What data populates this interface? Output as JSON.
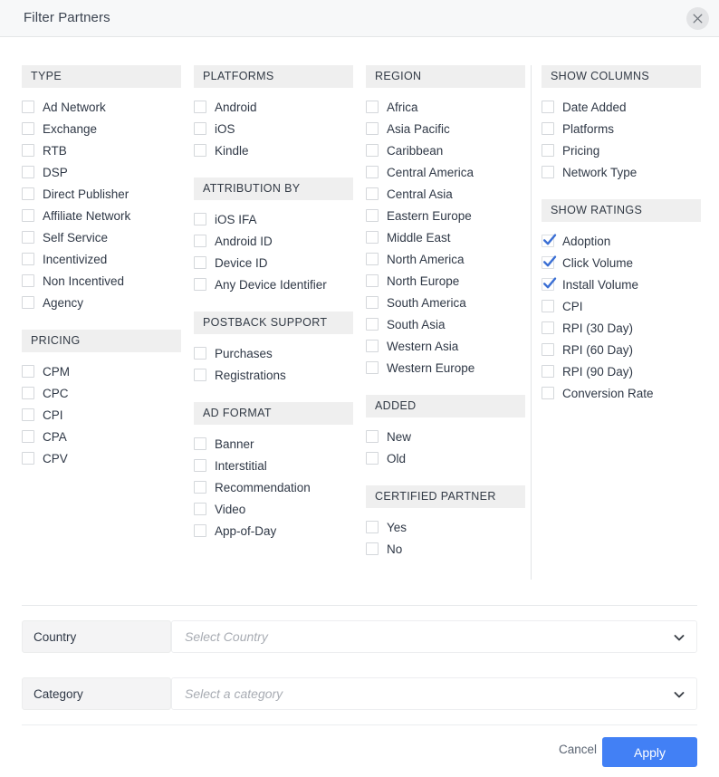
{
  "dialog": {
    "title": "Filter Partners",
    "close_icon": "close-icon"
  },
  "colors": {
    "accent": "#4280f5",
    "check": "#3b6fd4",
    "group_header_bg": "#efefef",
    "header_bg": "#f7f8f9"
  },
  "columns": [
    {
      "groups": [
        {
          "title": "TYPE",
          "options": [
            {
              "label": "Ad Network",
              "checked": false
            },
            {
              "label": "Exchange",
              "checked": false
            },
            {
              "label": "RTB",
              "checked": false
            },
            {
              "label": "DSP",
              "checked": false
            },
            {
              "label": "Direct Publisher",
              "checked": false
            },
            {
              "label": "Affiliate Network",
              "checked": false
            },
            {
              "label": "Self Service",
              "checked": false
            },
            {
              "label": "Incentivized",
              "checked": false
            },
            {
              "label": "Non Incentived",
              "checked": false
            },
            {
              "label": "Agency",
              "checked": false
            }
          ]
        },
        {
          "title": "PRICING",
          "options": [
            {
              "label": "CPM",
              "checked": false
            },
            {
              "label": "CPC",
              "checked": false
            },
            {
              "label": "CPI",
              "checked": false
            },
            {
              "label": "CPA",
              "checked": false
            },
            {
              "label": "CPV",
              "checked": false
            }
          ]
        }
      ]
    },
    {
      "groups": [
        {
          "title": "PLATFORMS",
          "options": [
            {
              "label": "Android",
              "checked": false
            },
            {
              "label": "iOS",
              "checked": false
            },
            {
              "label": "Kindle",
              "checked": false
            }
          ]
        },
        {
          "title": "ATTRIBUTION BY",
          "options": [
            {
              "label": "iOS IFA",
              "checked": false
            },
            {
              "label": "Android ID",
              "checked": false
            },
            {
              "label": "Device ID",
              "checked": false
            },
            {
              "label": "Any Device Identifier",
              "checked": false
            }
          ]
        },
        {
          "title": "POSTBACK SUPPORT",
          "options": [
            {
              "label": "Purchases",
              "checked": false
            },
            {
              "label": "Registrations",
              "checked": false
            }
          ]
        },
        {
          "title": "AD FORMAT",
          "options": [
            {
              "label": "Banner",
              "checked": false
            },
            {
              "label": "Interstitial",
              "checked": false
            },
            {
              "label": "Recommendation",
              "checked": false
            },
            {
              "label": "Video",
              "checked": false
            },
            {
              "label": "App-of-Day",
              "checked": false
            }
          ]
        }
      ]
    },
    {
      "groups": [
        {
          "title": "REGION",
          "options": [
            {
              "label": "Africa",
              "checked": false
            },
            {
              "label": "Asia Pacific",
              "checked": false
            },
            {
              "label": "Caribbean",
              "checked": false
            },
            {
              "label": "Central America",
              "checked": false
            },
            {
              "label": "Central Asia",
              "checked": false
            },
            {
              "label": "Eastern Europe",
              "checked": false
            },
            {
              "label": "Middle East",
              "checked": false
            },
            {
              "label": "North America",
              "checked": false
            },
            {
              "label": "North Europe",
              "checked": false
            },
            {
              "label": "South America",
              "checked": false
            },
            {
              "label": "South Asia",
              "checked": false
            },
            {
              "label": "Western Asia",
              "checked": false
            },
            {
              "label": "Western Europe",
              "checked": false
            }
          ]
        },
        {
          "title": "ADDED",
          "options": [
            {
              "label": "New",
              "checked": false
            },
            {
              "label": "Old",
              "checked": false
            }
          ]
        },
        {
          "title": "CERTIFIED PARTNER",
          "options": [
            {
              "label": "Yes",
              "checked": false
            },
            {
              "label": "No",
              "checked": false
            }
          ]
        }
      ]
    },
    {
      "groups": [
        {
          "title": "SHOW COLUMNS",
          "options": [
            {
              "label": "Date Added",
              "checked": false
            },
            {
              "label": "Platforms",
              "checked": false
            },
            {
              "label": "Pricing",
              "checked": false
            },
            {
              "label": "Network Type",
              "checked": false
            }
          ]
        },
        {
          "title": "SHOW RATINGS",
          "options": [
            {
              "label": "Adoption",
              "checked": true
            },
            {
              "label": "Click Volume",
              "checked": true
            },
            {
              "label": "Install Volume",
              "checked": true
            },
            {
              "label": "CPI",
              "checked": false
            },
            {
              "label": "RPI (30 Day)",
              "checked": false
            },
            {
              "label": "RPI (60 Day)",
              "checked": false
            },
            {
              "label": "RPI (90 Day)",
              "checked": false
            },
            {
              "label": "Conversion Rate",
              "checked": false
            }
          ]
        }
      ]
    }
  ],
  "fields": [
    {
      "label": "Country",
      "placeholder": "Select Country",
      "value": ""
    },
    {
      "label": "Category",
      "placeholder": "Select a category",
      "value": ""
    }
  ],
  "footer": {
    "cancel_label": "Cancel",
    "apply_label": "Apply"
  }
}
